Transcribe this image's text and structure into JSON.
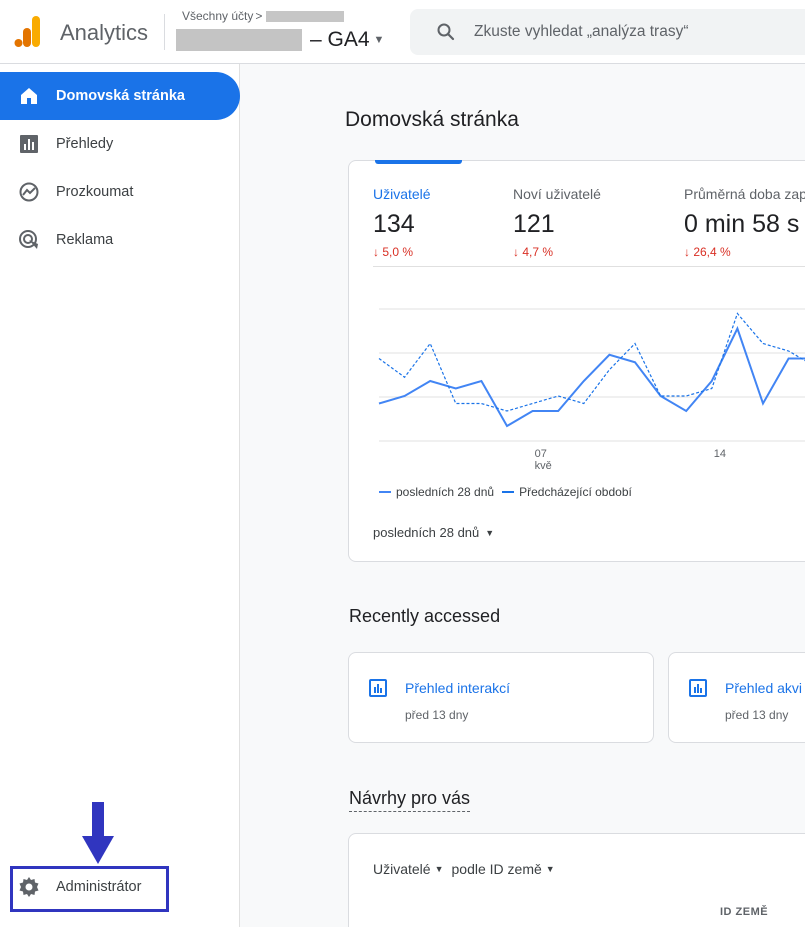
{
  "header": {
    "app_name": "Analytics",
    "breadcrumb_label": "Všechny účty",
    "breadcrumb_separator": ">",
    "property_name": "– GA4",
    "search_placeholder": "Zkuste vyhledat „analýza trasy“"
  },
  "sidebar": {
    "items": [
      {
        "label": "Domovská stránka",
        "icon": "home-icon",
        "active": true
      },
      {
        "label": "Přehledy",
        "icon": "bar-chart-icon",
        "active": false
      },
      {
        "label": "Prozkoumat",
        "icon": "explore-icon",
        "active": false
      },
      {
        "label": "Reklama",
        "icon": "advertising-icon",
        "active": false
      }
    ],
    "admin_label": "Administrátor",
    "highlight_color": "#3035bf"
  },
  "main": {
    "page_title": "Domovská stránka",
    "metrics": [
      {
        "label": "Uživatelé",
        "value": "134",
        "change": "↓ 5,0 %"
      },
      {
        "label": "Noví uživatelé",
        "value": "121",
        "change": "↓ 4,7 %"
      },
      {
        "label": "Průměrná doba zap",
        "value": "0 min 58 s",
        "change": "↓ 26,4 %"
      }
    ],
    "legend": {
      "current": "posledních 28 dnů",
      "previous": "Předcházející období"
    },
    "date_range": "posledních 28 dnů",
    "recently_accessed": {
      "title": "Recently accessed",
      "items": [
        {
          "title": "Přehled interakcí",
          "subtitle": "před 13 dny"
        },
        {
          "title": "Přehled akvi",
          "subtitle": "před 13 dny"
        }
      ]
    },
    "suggestions": {
      "title": "Návrhy pro vás",
      "metric_select": "Uživatelé",
      "dimension_select": "podle ID země",
      "column_header": "ID ZEMĚ"
    }
  },
  "chart_data": {
    "type": "line",
    "x_tick_labels": [
      "07",
      "kvě",
      "14"
    ],
    "x": [
      1,
      2,
      3,
      4,
      5,
      6,
      7,
      8,
      9,
      10,
      11,
      12,
      13,
      14,
      15,
      16,
      17,
      18,
      19
    ],
    "series": [
      {
        "name": "posledních 28 dnů",
        "style": "solid",
        "color": "#4285f4",
        "values": [
          5.0,
          6.0,
          8.0,
          7.0,
          8.0,
          2.0,
          4.0,
          4.0,
          8.0,
          11.5,
          10.5,
          6.0,
          4.0,
          8.0,
          15.0,
          5.0,
          11.0,
          11.0
        ]
      },
      {
        "name": "Předcházející období",
        "style": "dashed",
        "color": "#1a73e8",
        "values": [
          11.0,
          8.5,
          13.0,
          5.0,
          5.0,
          4.0,
          5.0,
          6.0,
          5.0,
          9.5,
          13.0,
          6.0,
          6.0,
          7.0,
          17.0,
          13.0,
          12.0,
          10.0
        ]
      }
    ],
    "ylim": [
      0,
      20
    ],
    "grid": true
  }
}
